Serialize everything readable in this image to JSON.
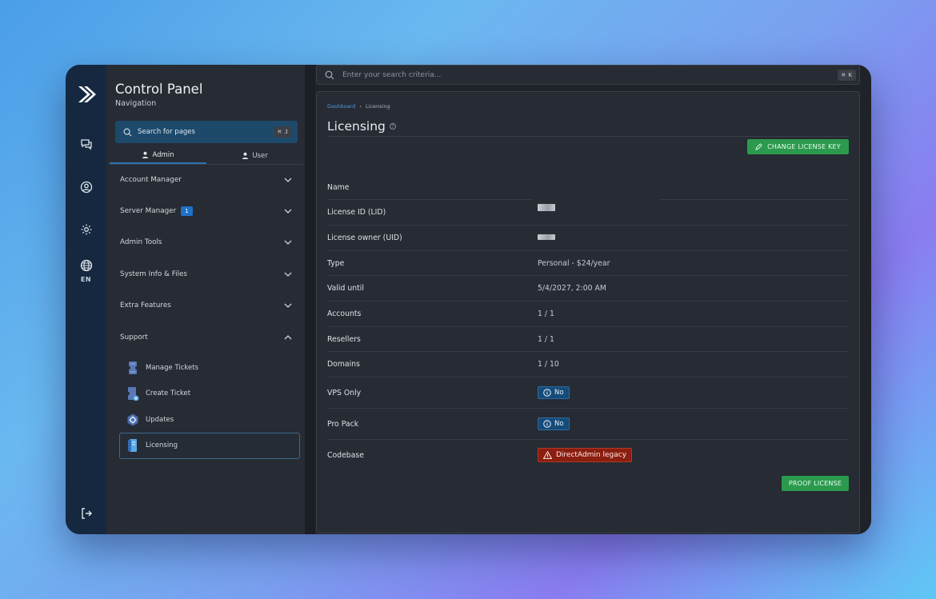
{
  "rail": {
    "icons": [
      "logo-icon",
      "chat-icon",
      "user-circle-icon",
      "gear-icon",
      "globe-icon",
      "logout-icon"
    ],
    "language": "EN"
  },
  "nav": {
    "title": "Control Panel",
    "subtitle": "Navigation",
    "search_placeholder": "Search for pages",
    "search_shortcut": "⌘ J",
    "roles": [
      {
        "label": "Admin",
        "active": true
      },
      {
        "label": "User",
        "active": false
      }
    ],
    "menu": [
      {
        "label": "Account Manager"
      },
      {
        "label": "Server Manager",
        "badge": "1"
      },
      {
        "label": "Admin Tools"
      },
      {
        "label": "System Info & Files"
      },
      {
        "label": "Extra Features"
      },
      {
        "label": "Support",
        "expanded": true
      }
    ],
    "support_items": [
      {
        "label": "Manage Tickets"
      },
      {
        "label": "Create Ticket"
      },
      {
        "label": "Updates"
      },
      {
        "label": "Licensing",
        "active": true
      }
    ]
  },
  "main": {
    "search_placeholder": "Enter your search criteria...",
    "search_shortcut": "⌘ K",
    "breadcrumb": {
      "home": "Dashboard",
      "separator": "›",
      "current": "Licensing"
    },
    "title": "Licensing",
    "change_key_label": "CHANGE LICENSE KEY",
    "proof_label": "PROOF LICENSE",
    "rows": {
      "name": {
        "key": "Name",
        "value": ""
      },
      "lid": {
        "key": "License ID (LID)"
      },
      "uid": {
        "key": "License owner (UID)"
      },
      "type": {
        "key": "Type",
        "value": "Personal - $24/year"
      },
      "valid": {
        "key": "Valid until",
        "value": "5/4/2027, 2:00 AM"
      },
      "accounts": {
        "key": "Accounts",
        "value": "1 / 1"
      },
      "resellers": {
        "key": "Resellers",
        "value": "1 / 1"
      },
      "domains": {
        "key": "Domains",
        "value": "1 / 10"
      },
      "vps": {
        "key": "VPS Only",
        "value": "No"
      },
      "propack": {
        "key": "Pro Pack",
        "value": "No"
      },
      "codebase": {
        "key": "Codebase",
        "value": "DirectAdmin legacy"
      }
    }
  },
  "colors": {
    "accent": "#1d4a6b",
    "success": "#2b9a4e",
    "info": "#164b78",
    "danger": "#8a1e10"
  }
}
